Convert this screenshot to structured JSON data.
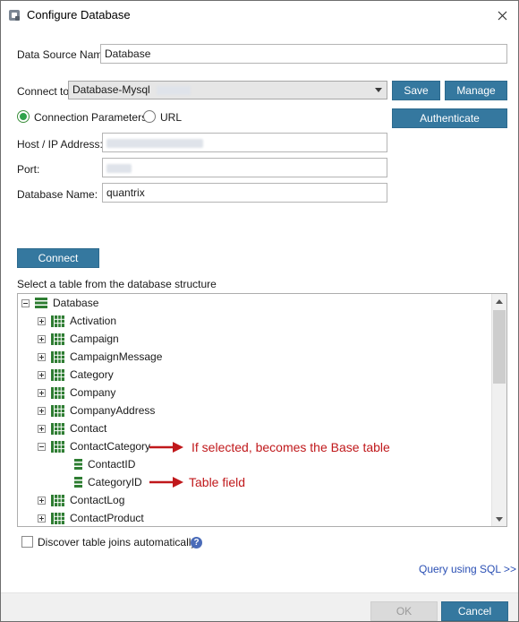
{
  "window": {
    "title": "Configure Database"
  },
  "data_source": {
    "label": "Data Source Name",
    "value": "Database"
  },
  "connect_to": {
    "label": "Connect to",
    "value": "Database-Mysql",
    "save": "Save",
    "manage": "Manage"
  },
  "connection": {
    "params_label": "Connection Parameters",
    "url_label": "URL",
    "selected": "Connection Parameters",
    "authenticate": "Authenticate"
  },
  "host": {
    "label": "Host / IP Address:",
    "value": ""
  },
  "port": {
    "label": "Port:",
    "value": ""
  },
  "dbname": {
    "label": "Database Name:",
    "value": "quantrix"
  },
  "connect_button": "Connect",
  "tree_prompt": "Select a table from the database structure",
  "tree": {
    "root": "Database",
    "items": [
      {
        "label": "Activation",
        "kind": "table",
        "state": "collapsed"
      },
      {
        "label": "Campaign",
        "kind": "table",
        "state": "collapsed"
      },
      {
        "label": "CampaignMessage",
        "kind": "table",
        "state": "collapsed"
      },
      {
        "label": "Category",
        "kind": "table",
        "state": "collapsed"
      },
      {
        "label": "Company",
        "kind": "table",
        "state": "collapsed"
      },
      {
        "label": "CompanyAddress",
        "kind": "table",
        "state": "collapsed"
      },
      {
        "label": "Contact",
        "kind": "table",
        "state": "collapsed"
      },
      {
        "label": "ContactCategory",
        "kind": "table",
        "state": "expanded"
      },
      {
        "label": "ContactID",
        "kind": "field"
      },
      {
        "label": "CategoryID",
        "kind": "field"
      },
      {
        "label": "ContactLog",
        "kind": "table",
        "state": "collapsed"
      },
      {
        "label": "ContactProduct",
        "kind": "table",
        "state": "collapsed"
      }
    ]
  },
  "annotations": {
    "base_table": "If selected, becomes the Base table",
    "table_field": "Table field"
  },
  "discover_joins": {
    "label": "Discover table joins automatically",
    "checked": false
  },
  "query_link": "Query using SQL >>",
  "footer": {
    "ok": "OK",
    "cancel": "Cancel"
  },
  "colors": {
    "accent": "#35789f",
    "annotation": "#c0181b",
    "tree_icon": "#2e7d32"
  }
}
